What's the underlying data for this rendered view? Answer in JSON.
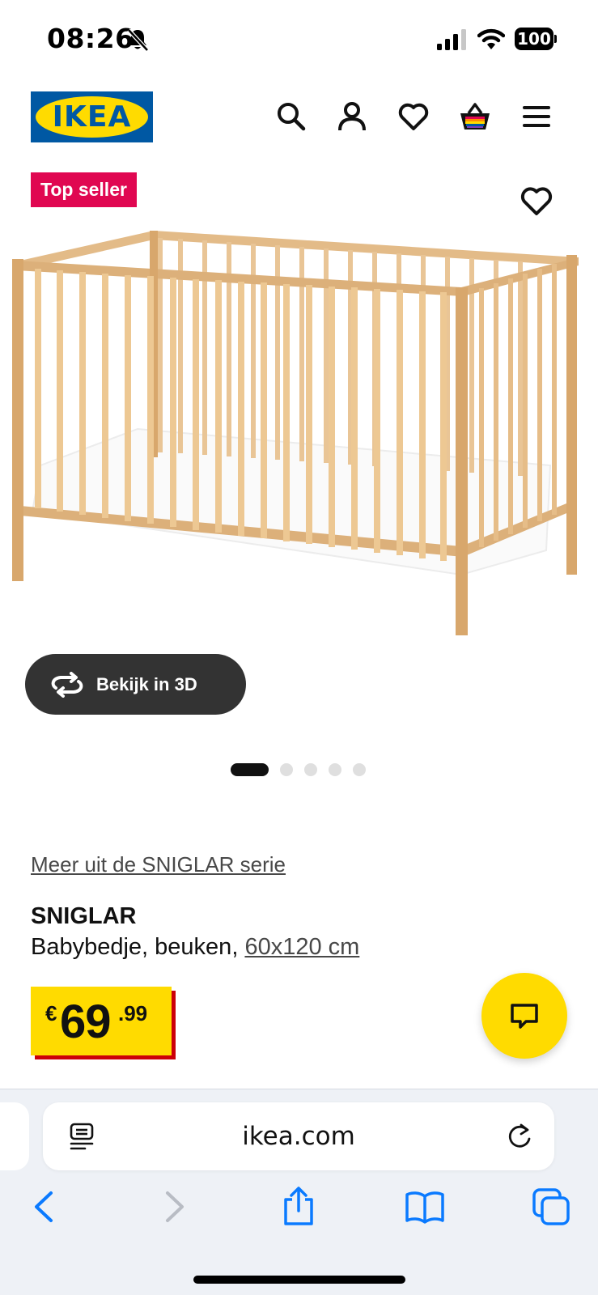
{
  "status_bar": {
    "time": "08:26",
    "battery": "100"
  },
  "header": {
    "logo_text": "IKEA",
    "icons": [
      "search-icon",
      "account-icon",
      "favourites-icon",
      "basket-icon",
      "menu-icon"
    ]
  },
  "product": {
    "badge": "Top seller",
    "view_3d_label": "Bekijk in 3D",
    "gallery": {
      "total_images": 5,
      "active_index": 0
    },
    "series_link": "Meer uit de SNIGLAR serie",
    "name": "SNIGLAR",
    "description": "Babybedje, beuken, ",
    "size": "60x120 cm",
    "price": {
      "currency": "€",
      "integer": "69",
      "decimals": ".99"
    }
  },
  "browser": {
    "url": "ikea.com"
  },
  "colors": {
    "ikea_blue": "#0058a3",
    "ikea_yellow": "#ffdb00",
    "badge_red": "#e00751",
    "price_shadow_red": "#cc0008",
    "ios_blue": "#0a7aff"
  }
}
